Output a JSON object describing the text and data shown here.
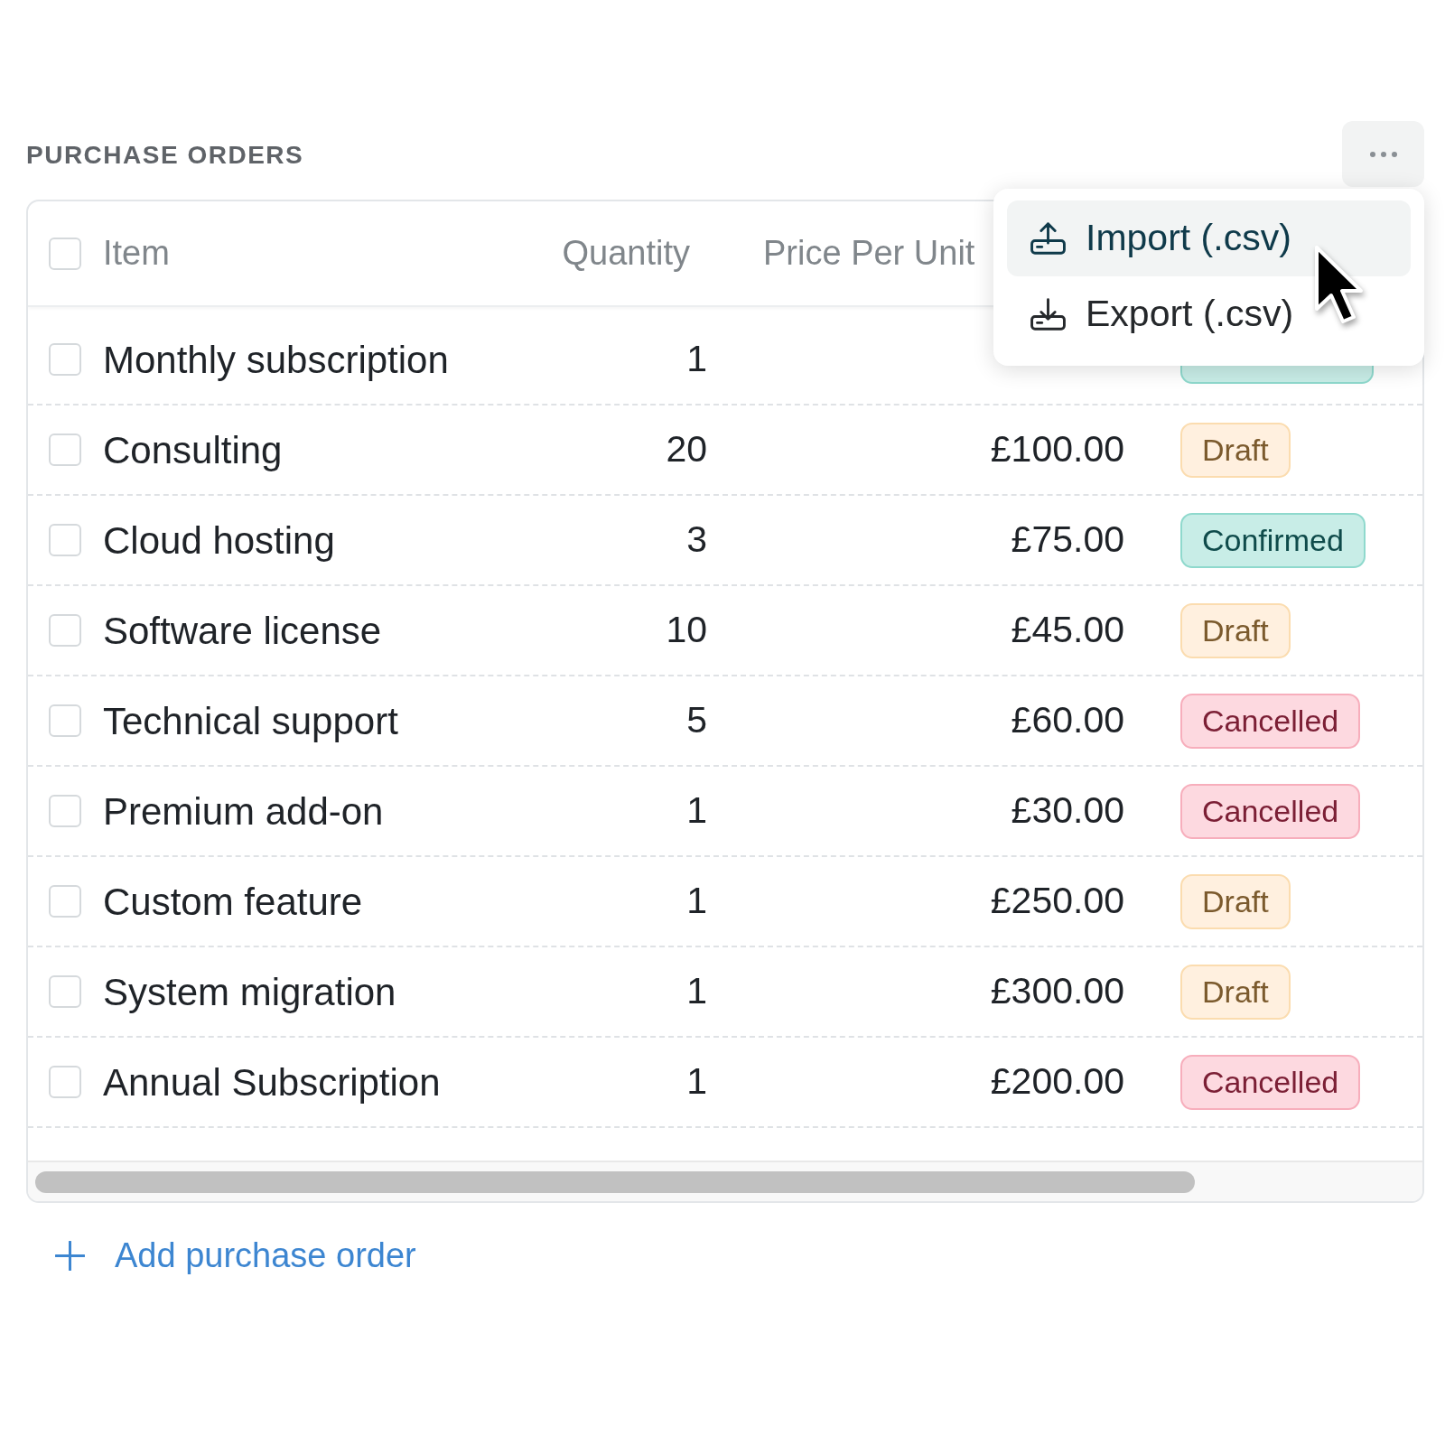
{
  "section": {
    "title": "PURCHASE ORDERS"
  },
  "more_button": {
    "menu_open": true
  },
  "menu": [
    {
      "label": "Import (.csv)",
      "kind": "import",
      "selected": true
    },
    {
      "label": "Export (.csv)",
      "kind": "export",
      "selected": false
    }
  ],
  "table": {
    "select_all_checked": false,
    "columns": [
      "Item",
      "Quantity",
      "Price Per Unit"
    ],
    "rows": [
      {
        "item": "Monthly subscription",
        "quantity": "1",
        "checked": false,
        "status": {
          "kind": "confirmed"
        }
      },
      {
        "item": "Consulting",
        "quantity": "20",
        "price": "£100.00",
        "checked": false,
        "status": {
          "label": "Draft",
          "kind": "draft"
        }
      },
      {
        "item": "Cloud hosting",
        "quantity": "3",
        "price": "£75.00",
        "checked": false,
        "status": {
          "label": "Confirmed",
          "kind": "confirmed"
        }
      },
      {
        "item": "Software license",
        "quantity": "10",
        "price": "£45.00",
        "checked": false,
        "status": {
          "label": "Draft",
          "kind": "draft"
        }
      },
      {
        "item": "Technical support",
        "quantity": "5",
        "price": "£60.00",
        "checked": false,
        "status": {
          "label": "Cancelled",
          "kind": "cancelled"
        }
      },
      {
        "item": "Premium add-on",
        "quantity": "1",
        "price": "£30.00",
        "checked": false,
        "status": {
          "label": "Cancelled",
          "kind": "cancelled"
        }
      },
      {
        "item": "Custom feature",
        "quantity": "1",
        "price": "£250.00",
        "checked": false,
        "status": {
          "label": "Draft",
          "kind": "draft"
        }
      },
      {
        "item": "System migration",
        "quantity": "1",
        "price": "£300.00",
        "checked": false,
        "status": {
          "label": "Draft",
          "kind": "draft"
        }
      },
      {
        "item": "Annual Subscription",
        "quantity": "1",
        "price": "£200.00",
        "checked": false,
        "status": {
          "label": "Cancelled",
          "kind": "cancelled"
        }
      }
    ]
  },
  "add_button": {
    "label": "Add purchase order"
  }
}
